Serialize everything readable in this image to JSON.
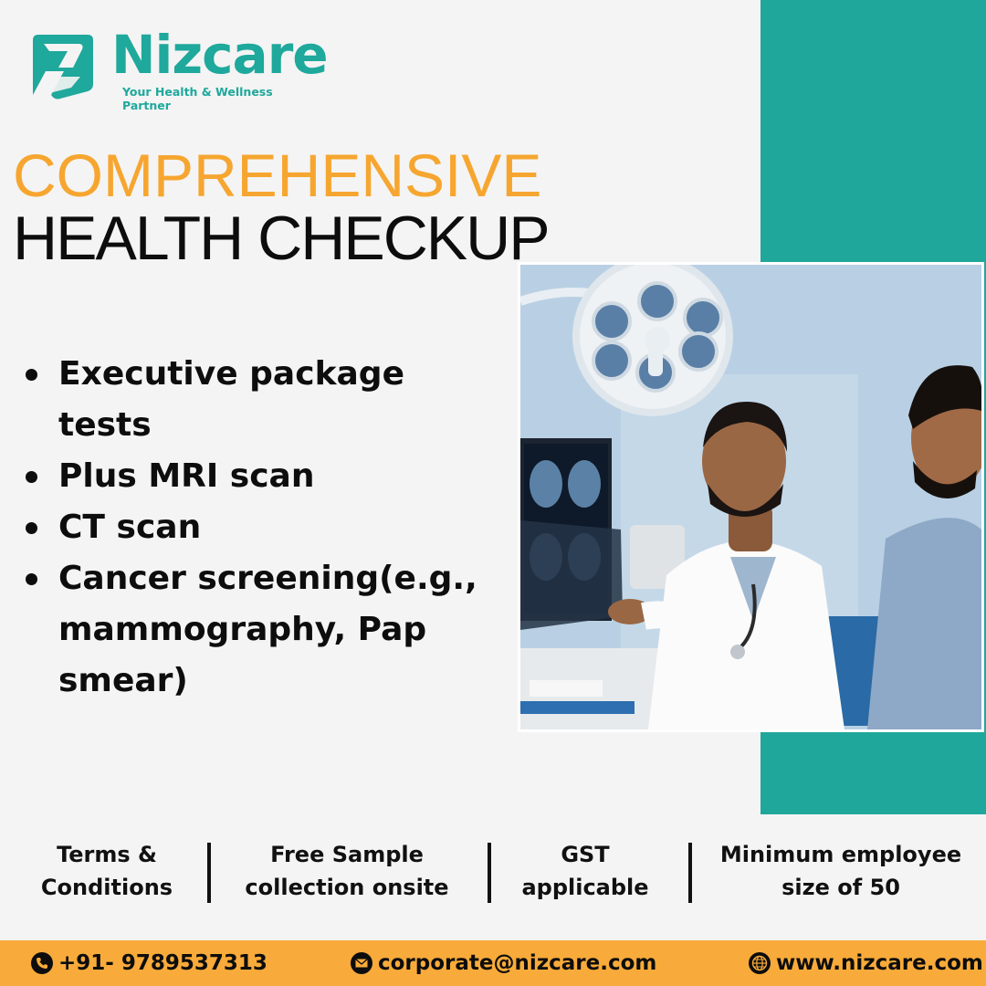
{
  "brand": {
    "name": "Nizcare",
    "tagline": "Your Health & Wellness Partner",
    "teal": "#20a79b",
    "orange": "#f8ab3a"
  },
  "headline": {
    "line1": "COMPREHENSIVE",
    "line2": "HEALTH CHECKUP"
  },
  "bullets": [
    "Executive package tests",
    "Plus MRI scan",
    "CT scan",
    "Cancer screening(e.g., mammography, Pap smear)"
  ],
  "terms": [
    {
      "line1": "Terms &",
      "line2": "Conditions"
    },
    {
      "line1": "Free Sample",
      "line2": "collection onsite"
    },
    {
      "line1": "GST",
      "line2": "applicable"
    },
    {
      "line1": "Minimum employee",
      "line2": "size of 50"
    }
  ],
  "contact": {
    "phone": "+91- 9789537313",
    "email": "corporate@nizcare.com",
    "website": "www.nizcare.com",
    "phone_icon": "phone-icon",
    "email_icon": "mail-icon",
    "website_icon": "globe-icon"
  }
}
